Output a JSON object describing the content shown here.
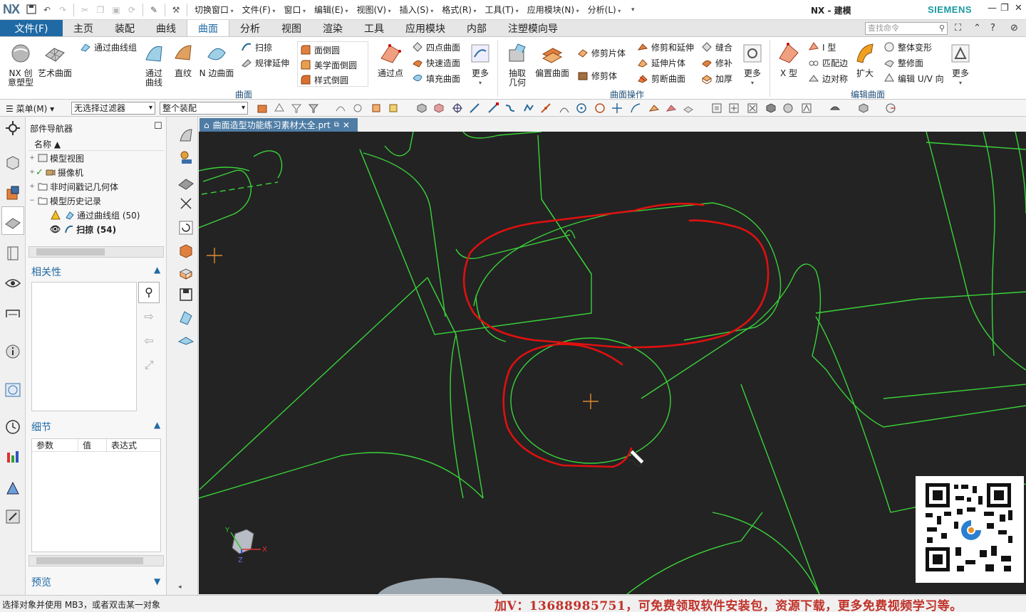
{
  "app": {
    "logo": "NX",
    "title": "NX - 建模",
    "brand": "SIEMENS",
    "brand_color": "#1a9aa0",
    "accent_color": "#1f6aa5"
  },
  "top_menu": [
    "切换窗口",
    "文件(F)",
    "窗口",
    "编辑(E)",
    "视图(V)",
    "插入(S)",
    "格式(R)",
    "工具(T)",
    "应用模块(N)",
    "分析(L)"
  ],
  "ribbon_tabs": {
    "file": "文件(F)",
    "items": [
      "主页",
      "装配",
      "曲线",
      "曲面",
      "分析",
      "视图",
      "渲染",
      "工具",
      "应用模块",
      "内部",
      "注塑模向导"
    ],
    "active": "曲面"
  },
  "search": {
    "placeholder": "查找命令"
  },
  "ribbon": {
    "g1": {
      "nx_create": "NX 创\n意塑型",
      "art_surface": "艺术曲面",
      "through_curves_group": "通过曲线组",
      "through_curves": "通过\n曲线",
      "ruled": "直纹",
      "n_side": "N 边曲面",
      "sweep": "扫掠",
      "law_extend": "规律延伸",
      "face_blend": "面倒圆",
      "aesthetic_blend": "美学面倒圆",
      "styled_blend": "样式倒圆",
      "through_points": "通过点",
      "four_point": "四点曲面",
      "quick_surface": "快速造面",
      "fill_surface": "填充曲面",
      "more": "更多",
      "label": "曲面"
    },
    "g2": {
      "extract": "抽取\n几何",
      "offset_surface": "偏置曲面",
      "trim_body": "修剪片体",
      "trim_sheet": "修剪体",
      "trim_extend": "修剪和延伸",
      "extend_sheet": "延伸片体",
      "divide_face": "剪断曲面",
      "sew": "缝合",
      "patch": "修补",
      "thicken": "加厚",
      "more": "更多",
      "label": "曲面操作"
    },
    "g3": {
      "x_form": "X 型",
      "i_form": "I 型",
      "match_edge": "匹配边",
      "edge_sym": "边对称",
      "enlarge": "扩大",
      "global_shape": "整体变形",
      "refit": "整修面",
      "edit_uv": "编辑 U/V 向",
      "more": "更多",
      "label": "编辑曲面"
    }
  },
  "toolbar2": {
    "menu": "菜单(M)",
    "filter": "无选择过滤器",
    "assembly": "整个装配"
  },
  "navigator": {
    "title": "部件导航器",
    "col_name": "名称",
    "tree": [
      {
        "label": "模型视图",
        "expand": "+"
      },
      {
        "label": "摄像机",
        "expand": "+"
      },
      {
        "label": "非时间戳记几何体",
        "expand": "+"
      },
      {
        "label": "模型历史记录",
        "expand": "−"
      },
      {
        "label": "通过曲线组 (50)",
        "expand": ""
      },
      {
        "label": "扫掠 (54)",
        "expand": ""
      }
    ],
    "relevance": "相关性",
    "details": "细节",
    "details_cols": [
      "参数",
      "值",
      "表达式"
    ],
    "preview": "预览"
  },
  "document": {
    "tab": "曲面造型功能练习素材大全.prt"
  },
  "axes": {
    "x": "X",
    "y": "Y",
    "z": "Z"
  },
  "status": {
    "prompt": "选择对象并使用 MB3，或者双击某一对象",
    "promo": "加V：13688985751，可免费领取软件安装包，资源下载，更多免费视频学习等。",
    "promo_color": "#c0322a"
  }
}
